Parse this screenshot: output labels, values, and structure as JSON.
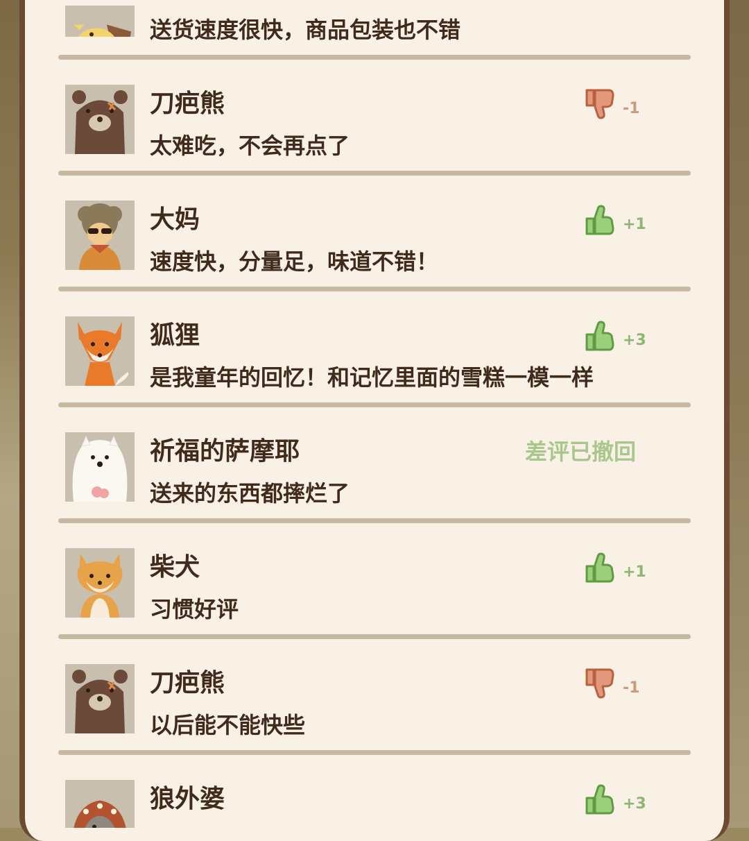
{
  "colors": {
    "panel_bg": "#f9f1e5",
    "frame": "#6e4a35",
    "text": "#3f2a1c",
    "thumb_up": "#8fc36f",
    "thumb_down": "#d98b65",
    "withdrawn": "#a9c78d"
  },
  "reviews": [
    {
      "name": "",
      "comment": "送货速度很快，商品包装也不错",
      "avatar_icon": "chick-avatar-icon"
    },
    {
      "name": "刀疤熊",
      "comment": "太难吃，不会再点了",
      "rating": "thumb-down",
      "score": "-1",
      "avatar_icon": "scarred-bear-avatar-icon"
    },
    {
      "name": "大妈",
      "comment": "速度快，分量足，味道不错！",
      "rating": "thumb-up",
      "score": "+1",
      "avatar_icon": "auntie-avatar-icon"
    },
    {
      "name": "狐狸",
      "comment": "是我童年的回忆！和记忆里面的雪糕一模一样",
      "rating": "thumb-up",
      "score": "+3",
      "avatar_icon": "fox-avatar-icon"
    },
    {
      "name": "祈福的萨摩耶",
      "comment": "送来的东西都摔烂了",
      "status": "差评已撤回",
      "avatar_icon": "samoyed-avatar-icon"
    },
    {
      "name": "柴犬",
      "comment": "习惯好评",
      "rating": "thumb-up",
      "score": "+1",
      "avatar_icon": "shiba-avatar-icon"
    },
    {
      "name": "刀疤熊",
      "comment": "以后能不能快些",
      "rating": "thumb-down",
      "score": "-1",
      "avatar_icon": "scarred-bear-avatar-icon"
    },
    {
      "name": "狼外婆",
      "comment": "",
      "rating": "thumb-up",
      "score": "+3",
      "avatar_icon": "wolf-grandma-avatar-icon"
    }
  ]
}
